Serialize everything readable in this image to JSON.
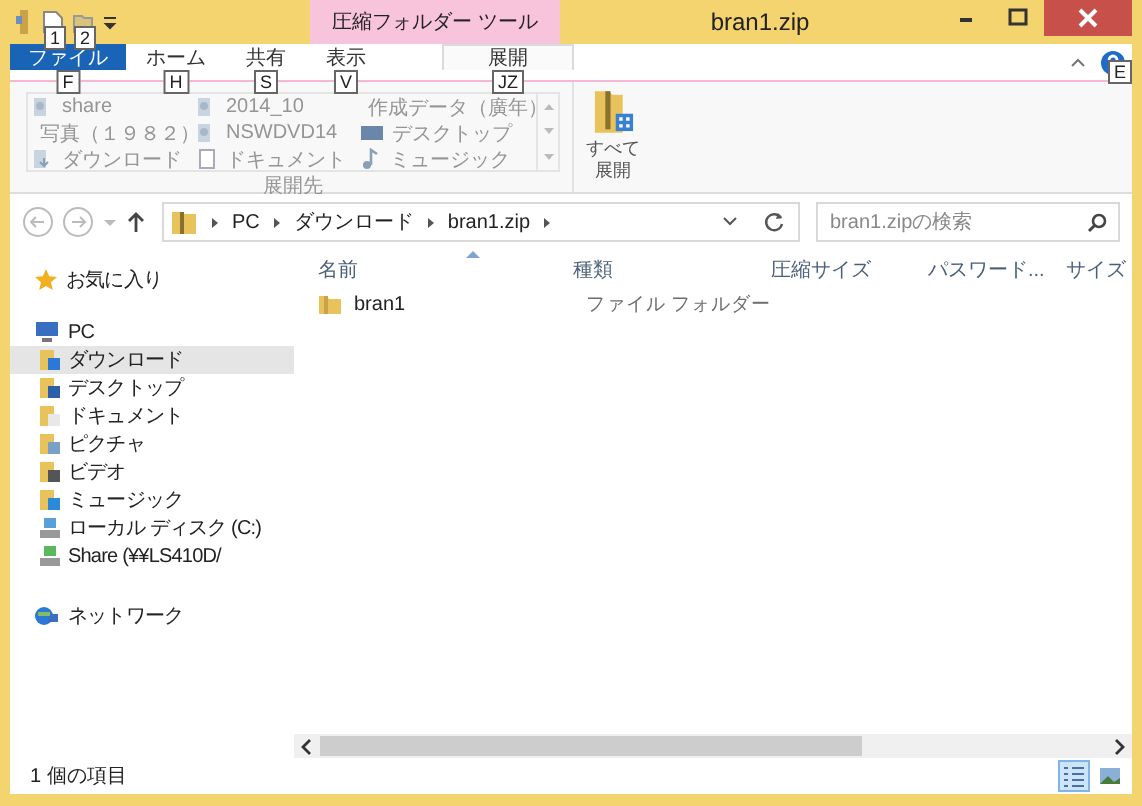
{
  "window": {
    "title": "bran1.zip",
    "contextual_tab": "圧縮フォルダー ツール"
  },
  "quick_access": {
    "keytips": [
      "1",
      "2"
    ]
  },
  "tabs": [
    {
      "label": "ファイル",
      "keytip": "F",
      "kind": "file",
      "selected": false
    },
    {
      "label": "ホーム",
      "keytip": "H",
      "kind": "tab",
      "selected": false
    },
    {
      "label": "共有",
      "keytip": "S",
      "kind": "tab",
      "selected": false
    },
    {
      "label": "表示",
      "keytip": "V",
      "kind": "tab",
      "selected": false
    },
    {
      "label": "展開",
      "keytip": "JZ",
      "kind": "tab",
      "selected": true
    }
  ],
  "help_keytip": "E",
  "ribbon": {
    "destinations": [
      {
        "label": "share",
        "kind": "user"
      },
      {
        "label": "写真（１９８２）",
        "kind": "user"
      },
      {
        "label": "ダウンロード",
        "kind": "download"
      },
      {
        "label": "2014_10",
        "kind": "user"
      },
      {
        "label": "NSWDVD14",
        "kind": "user"
      },
      {
        "label": "ドキュメント",
        "kind": "document"
      },
      {
        "label": "作成データ（廣年）",
        "kind": "user"
      },
      {
        "label": "デスクトップ",
        "kind": "desktop"
      },
      {
        "label": "ミュージック",
        "kind": "music"
      }
    ],
    "group_label": "展開先",
    "extract_all": [
      "すべて",
      "展開"
    ]
  },
  "address": {
    "segments": [
      "PC",
      "ダウンロード",
      "bran1.zip"
    ],
    "search_placeholder": "bran1.zipの検索"
  },
  "nav": {
    "favorites": "お気に入り",
    "pc": "PC",
    "items": [
      {
        "label": "ダウンロード",
        "kind": "download",
        "selected": true
      },
      {
        "label": "デスクトップ",
        "kind": "desktop",
        "selected": false
      },
      {
        "label": "ドキュメント",
        "kind": "document",
        "selected": false
      },
      {
        "label": "ピクチャ",
        "kind": "picture",
        "selected": false
      },
      {
        "label": "ビデオ",
        "kind": "video",
        "selected": false
      },
      {
        "label": "ミュージック",
        "kind": "music",
        "selected": false
      },
      {
        "label": "ローカル ディスク (C:)",
        "kind": "drive",
        "selected": false
      },
      {
        "label": "Share (¥¥LS410D/",
        "kind": "share",
        "selected": false
      }
    ],
    "network": "ネットワーク"
  },
  "columns": [
    "名前",
    "種類",
    "圧縮サイズ",
    "パスワード...",
    "サイズ"
  ],
  "rows": [
    {
      "name": "bran1",
      "type": "ファイル フォルダー"
    }
  ],
  "status_bar": {
    "count": "1 個の項目",
    "views": [
      {
        "kind": "details",
        "selected": true
      },
      {
        "kind": "tiles",
        "selected": false
      }
    ]
  }
}
